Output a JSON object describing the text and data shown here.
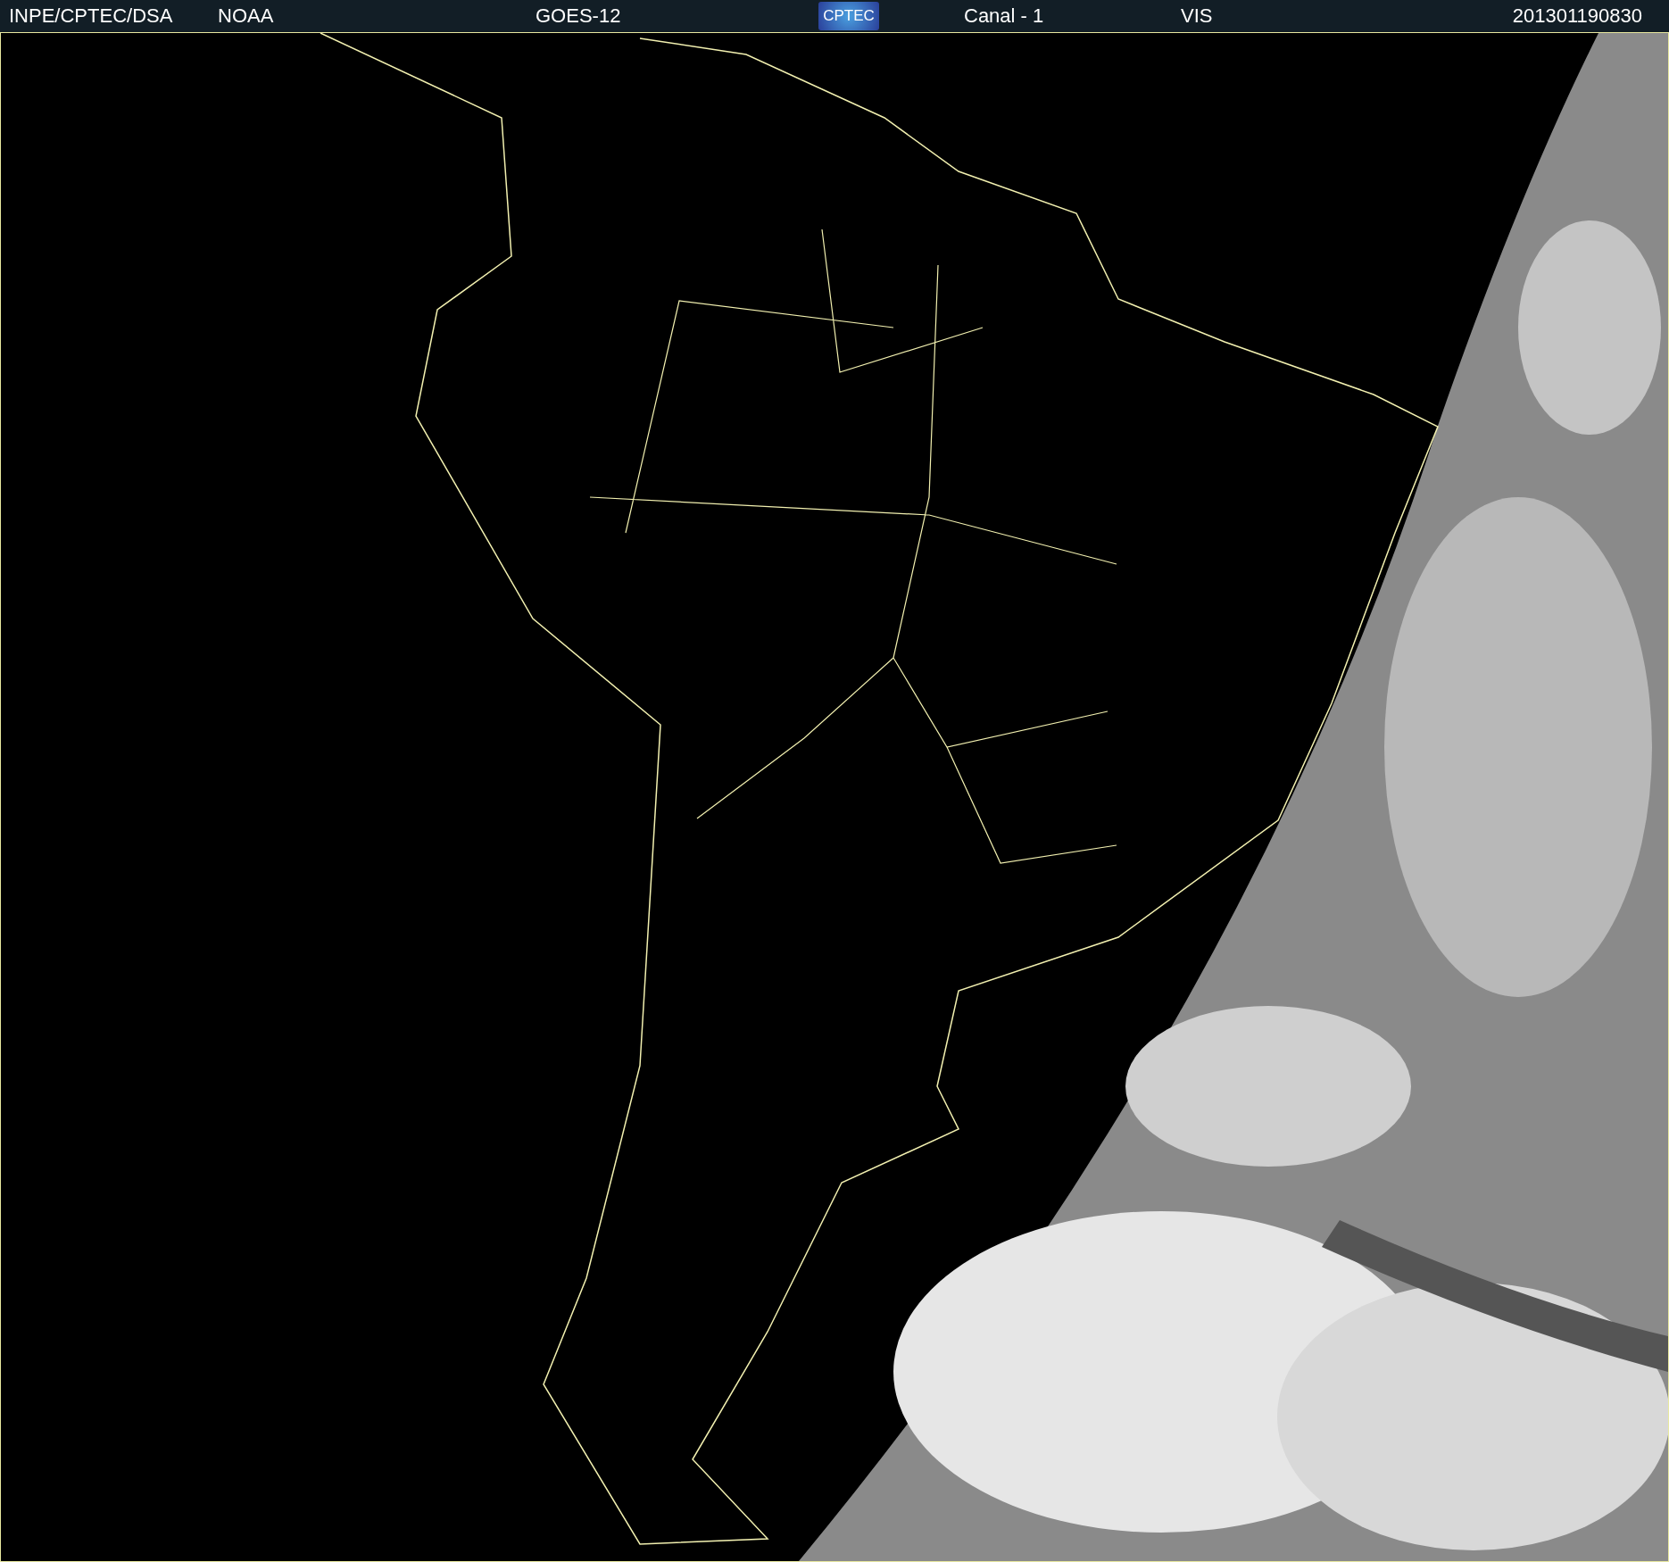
{
  "header": {
    "source": "INPE/CPTEC/DSA",
    "agency": "NOAA",
    "satellite": "GOES-12",
    "logo": "CPTEC",
    "channel": "Canal - 1",
    "band": "VIS",
    "timestamp": "201301190830"
  }
}
